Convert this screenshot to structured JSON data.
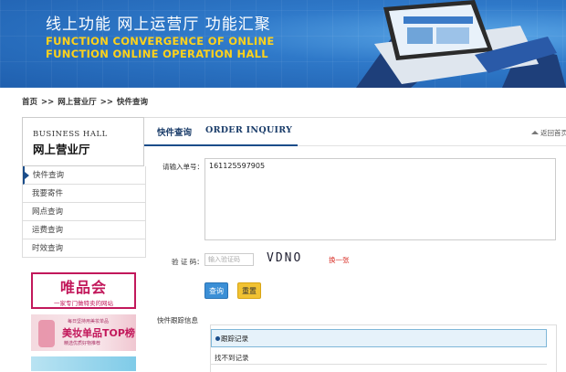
{
  "banner": {
    "title_cn": "线上功能 网上运营厅 功能汇聚",
    "title_en_1": "FUNCTION CONVERGENCE OF ONLINE",
    "title_en_2": "FUNCTION ONLINE OPERATION HALL"
  },
  "breadcrumb": [
    "首页",
    ">>",
    "网上营业厅",
    ">>",
    "快件查询"
  ],
  "sidebar": {
    "title_en": "BUSINESS HALL",
    "title_cn": "网上营业厅",
    "items": [
      {
        "label": "快件查询",
        "active": true
      },
      {
        "label": "我要寄件",
        "active": false
      },
      {
        "label": "网点查询",
        "active": false
      },
      {
        "label": "运费查询",
        "active": false
      },
      {
        "label": "时效查询",
        "active": false
      }
    ],
    "ads": {
      "ad1_logo": "唯品会",
      "ad1_sub": "一家专门做特卖的网站",
      "ad2_small": "每日坚持用美妆单品",
      "ad2_big": "美妆单品TOP榜",
      "ad2_sub": "精选优质好物推荐"
    }
  },
  "main": {
    "tab_cn": "快件查询",
    "tab_en": "ORDER INQUIRY",
    "back_label": "返回首页",
    "waybill_label": "请输入单号：",
    "waybill_value": "161125597905",
    "captcha_label": "验 证 码：",
    "captcha_placeholder": "输入验证码",
    "captcha_text": "VDNO",
    "captcha_change": "换一张",
    "query_button": "查询",
    "reset_button": "重置",
    "tracking_label": "快件跟踪信息",
    "tracking_header": "跟踪记录",
    "tracking_empty": "找不到记录"
  },
  "colors": {
    "banner_blue": "#2f79c9",
    "banner_yellow": "#ffd21a",
    "nav_dark": "#1b4d8a",
    "query_button": "#3b8fd6",
    "reset_button": "#f1c232",
    "captcha_change": "#d9332b"
  }
}
